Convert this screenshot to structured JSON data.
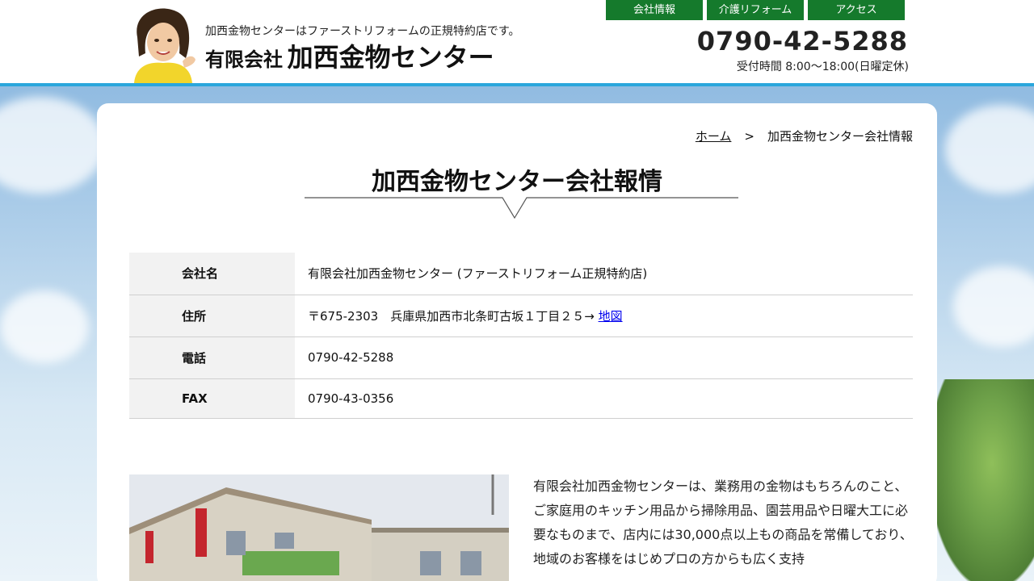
{
  "header": {
    "tagline": "加西金物センターはファーストリフォームの正規特約店です。",
    "company_prefix": "有限会社",
    "company_name": "加西金物センター",
    "phone": "0790-42-5288",
    "hours": "受付時間 8:00〜18:00(日曜定休)",
    "nav": [
      "会社情報",
      "介護リフォーム",
      "アクセス"
    ],
    "colors": {
      "nav": "#157a2c",
      "accent_bar": "#2aa6dc"
    }
  },
  "breadcrumb": {
    "home": "ホーム",
    "separator": ">",
    "current": "加西金物センター会社情報"
  },
  "page_title": "加西金物センター会社報情",
  "company_info": [
    {
      "label": "会社名",
      "value": "有限会社加西金物センター (ファーストリフォーム正規特約店)"
    },
    {
      "label": "住所",
      "value": "〒675-2303　兵庫県加西市北条町古坂１丁目２５→ ",
      "link": "地図"
    },
    {
      "label": "電話",
      "value": "0790-42-5288"
    },
    {
      "label": "FAX",
      "value": "0790-43-0356"
    }
  ],
  "description": "有限会社加西金物センターは、業務用の金物はもちろんのこと、ご家庭用のキッチン用品から掃除用品、園芸用品や日曜大工に必要なものまで、店内には30,000点以上もの商品を常備しており、地域のお客様をはじめプロの方からも広く支持"
}
